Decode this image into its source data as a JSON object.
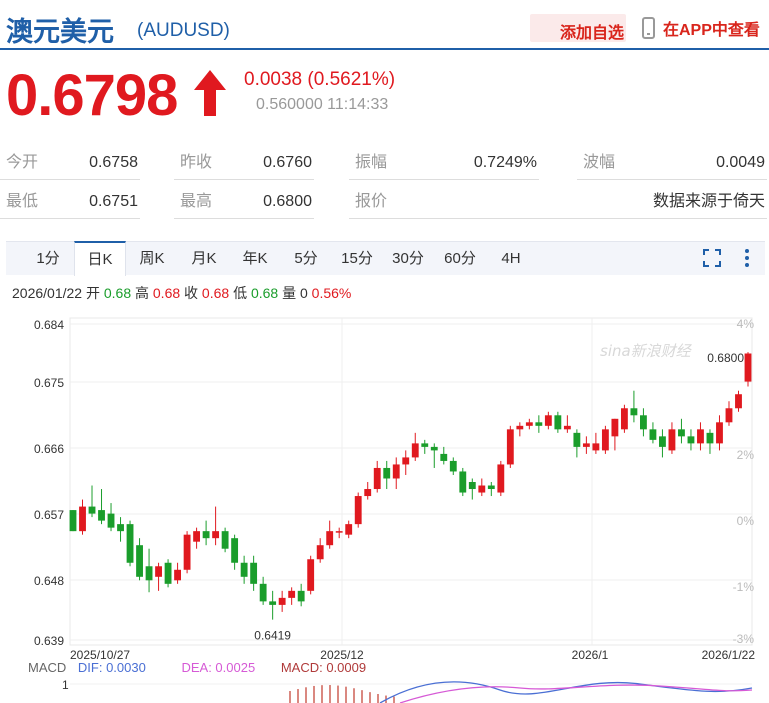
{
  "header": {
    "name": "澳元美元",
    "code": "(AUDUSD)",
    "add_fav": "添加自选",
    "view_app": "在APP中查看"
  },
  "quote": {
    "price": "0.6798",
    "change": "0.0038 (0.5621%)",
    "sub": "0.560000 11:14:33"
  },
  "stats": [
    {
      "label": "今开",
      "value": "0.6758"
    },
    {
      "label": "昨收",
      "value": "0.6760"
    },
    {
      "label": "振幅",
      "value": "0.7249%"
    },
    {
      "label": "波幅",
      "value": "0.0049"
    },
    {
      "label": "最低",
      "value": "0.6751"
    },
    {
      "label": "最高",
      "value": "0.6800"
    },
    {
      "label": "报价",
      "value": ""
    },
    {
      "label": "",
      "value": "数据来源于倚天"
    }
  ],
  "tabs": [
    "1分",
    "日K",
    "周K",
    "月K",
    "年K",
    "5分",
    "15分",
    "30分",
    "60分",
    "4H"
  ],
  "active_tab": 1,
  "info": {
    "date": "2026/01/22",
    "open_label": "开",
    "open": "0.68",
    "high_label": "高",
    "high": "0.68",
    "close_label": "收",
    "close": "0.68",
    "low_label": "低",
    "low": "0.68",
    "vol_label": "量",
    "vol": "0",
    "pct": "0.56%"
  },
  "macd": {
    "label": "MACD",
    "dif": "DIF: 0.0030",
    "dea": "DEA: 0.0025",
    "macd": "MACD: 0.0009",
    "axis_top": "1"
  },
  "colors": {
    "up": "#e0191f",
    "down": "#1a9d2b",
    "accent": "#1f5fa8"
  },
  "chart_data": {
    "type": "candlestick",
    "y_ticks": [
      "0.684",
      "0.675",
      "0.666",
      "0.657",
      "0.648",
      "0.639"
    ],
    "y_right_ticks": [
      "4%",
      "2%",
      "0%",
      "-1%",
      "-3%"
    ],
    "ylim": [
      0.639,
      0.684
    ],
    "x_labels": [
      "2025/10/27",
      "2025/12",
      "2026/1",
      "2026/1/22"
    ],
    "annotations": {
      "max": "0.6800",
      "min": "0.6419"
    },
    "candles": [
      [
        0.6575,
        0.6545,
        0.6575,
        0.6545
      ],
      [
        0.6545,
        0.658,
        0.659,
        0.654
      ],
      [
        0.658,
        0.657,
        0.661,
        0.6565
      ],
      [
        0.6575,
        0.656,
        0.6605,
        0.6555
      ],
      [
        0.657,
        0.655,
        0.6585,
        0.6545
      ],
      [
        0.6555,
        0.6545,
        0.6565,
        0.653
      ],
      [
        0.6555,
        0.65,
        0.656,
        0.6495
      ],
      [
        0.6525,
        0.648,
        0.6535,
        0.6475
      ],
      [
        0.6495,
        0.6475,
        0.652,
        0.6458
      ],
      [
        0.648,
        0.6495,
        0.65,
        0.646
      ],
      [
        0.65,
        0.647,
        0.6505,
        0.6465
      ],
      [
        0.6475,
        0.649,
        0.65,
        0.647
      ],
      [
        0.649,
        0.654,
        0.6545,
        0.6485
      ],
      [
        0.653,
        0.6545,
        0.655,
        0.652
      ],
      [
        0.6545,
        0.6535,
        0.656,
        0.6525
      ],
      [
        0.6535,
        0.6545,
        0.658,
        0.6525
      ],
      [
        0.6545,
        0.652,
        0.655,
        0.6515
      ],
      [
        0.6535,
        0.65,
        0.654,
        0.649
      ],
      [
        0.65,
        0.648,
        0.651,
        0.647
      ],
      [
        0.65,
        0.647,
        0.651,
        0.646
      ],
      [
        0.647,
        0.6445,
        0.648,
        0.644
      ],
      [
        0.6445,
        0.644,
        0.646,
        0.6419
      ],
      [
        0.644,
        0.645,
        0.646,
        0.643
      ],
      [
        0.645,
        0.646,
        0.6465,
        0.644
      ],
      [
        0.646,
        0.6445,
        0.647,
        0.6438
      ],
      [
        0.646,
        0.6505,
        0.651,
        0.6455
      ],
      [
        0.6505,
        0.6525,
        0.6535,
        0.65
      ],
      [
        0.6525,
        0.6545,
        0.656,
        0.652
      ],
      [
        0.6545,
        0.6545,
        0.655,
        0.6535
      ],
      [
        0.654,
        0.6555,
        0.656,
        0.6535
      ],
      [
        0.6555,
        0.6595,
        0.66,
        0.655
      ],
      [
        0.6595,
        0.6605,
        0.6615,
        0.659
      ],
      [
        0.6605,
        0.6635,
        0.6645,
        0.66
      ],
      [
        0.6635,
        0.662,
        0.6645,
        0.6605
      ],
      [
        0.662,
        0.664,
        0.665,
        0.6605
      ],
      [
        0.664,
        0.665,
        0.666,
        0.6625
      ],
      [
        0.665,
        0.667,
        0.6685,
        0.6645
      ],
      [
        0.667,
        0.6665,
        0.6675,
        0.6655
      ],
      [
        0.6665,
        0.666,
        0.667,
        0.6635
      ],
      [
        0.6655,
        0.6645,
        0.6665,
        0.664
      ],
      [
        0.6645,
        0.663,
        0.665,
        0.6625
      ],
      [
        0.663,
        0.66,
        0.6635,
        0.6595
      ],
      [
        0.6615,
        0.6605,
        0.662,
        0.659
      ],
      [
        0.66,
        0.661,
        0.662,
        0.6595
      ],
      [
        0.661,
        0.6605,
        0.6615,
        0.6595
      ],
      [
        0.66,
        0.664,
        0.6645,
        0.6595
      ],
      [
        0.664,
        0.669,
        0.6695,
        0.6635
      ],
      [
        0.669,
        0.6695,
        0.67,
        0.668
      ],
      [
        0.6695,
        0.67,
        0.6705,
        0.669
      ],
      [
        0.67,
        0.6695,
        0.671,
        0.6685
      ],
      [
        0.6695,
        0.671,
        0.6715,
        0.669
      ],
      [
        0.671,
        0.669,
        0.6715,
        0.6685
      ],
      [
        0.669,
        0.6695,
        0.671,
        0.6685
      ],
      [
        0.6685,
        0.6665,
        0.669,
        0.665
      ],
      [
        0.6665,
        0.667,
        0.668,
        0.6655
      ],
      [
        0.666,
        0.667,
        0.6685,
        0.6655
      ],
      [
        0.666,
        0.669,
        0.6695,
        0.6655
      ],
      [
        0.668,
        0.6705,
        0.6705,
        0.666
      ],
      [
        0.669,
        0.672,
        0.6725,
        0.6685
      ],
      [
        0.672,
        0.671,
        0.6745,
        0.67
      ],
      [
        0.671,
        0.669,
        0.672,
        0.668
      ],
      [
        0.669,
        0.6675,
        0.67,
        0.667
      ],
      [
        0.668,
        0.6665,
        0.669,
        0.665
      ],
      [
        0.666,
        0.669,
        0.67,
        0.6655
      ],
      [
        0.669,
        0.668,
        0.6705,
        0.667
      ],
      [
        0.668,
        0.667,
        0.669,
        0.666
      ],
      [
        0.667,
        0.669,
        0.67,
        0.666
      ],
      [
        0.6685,
        0.667,
        0.669,
        0.6655
      ],
      [
        0.667,
        0.67,
        0.671,
        0.666
      ],
      [
        0.67,
        0.672,
        0.673,
        0.6695
      ],
      [
        0.672,
        0.674,
        0.6745,
        0.6715
      ],
      [
        0.6758,
        0.6798,
        0.68,
        0.6751
      ]
    ]
  }
}
